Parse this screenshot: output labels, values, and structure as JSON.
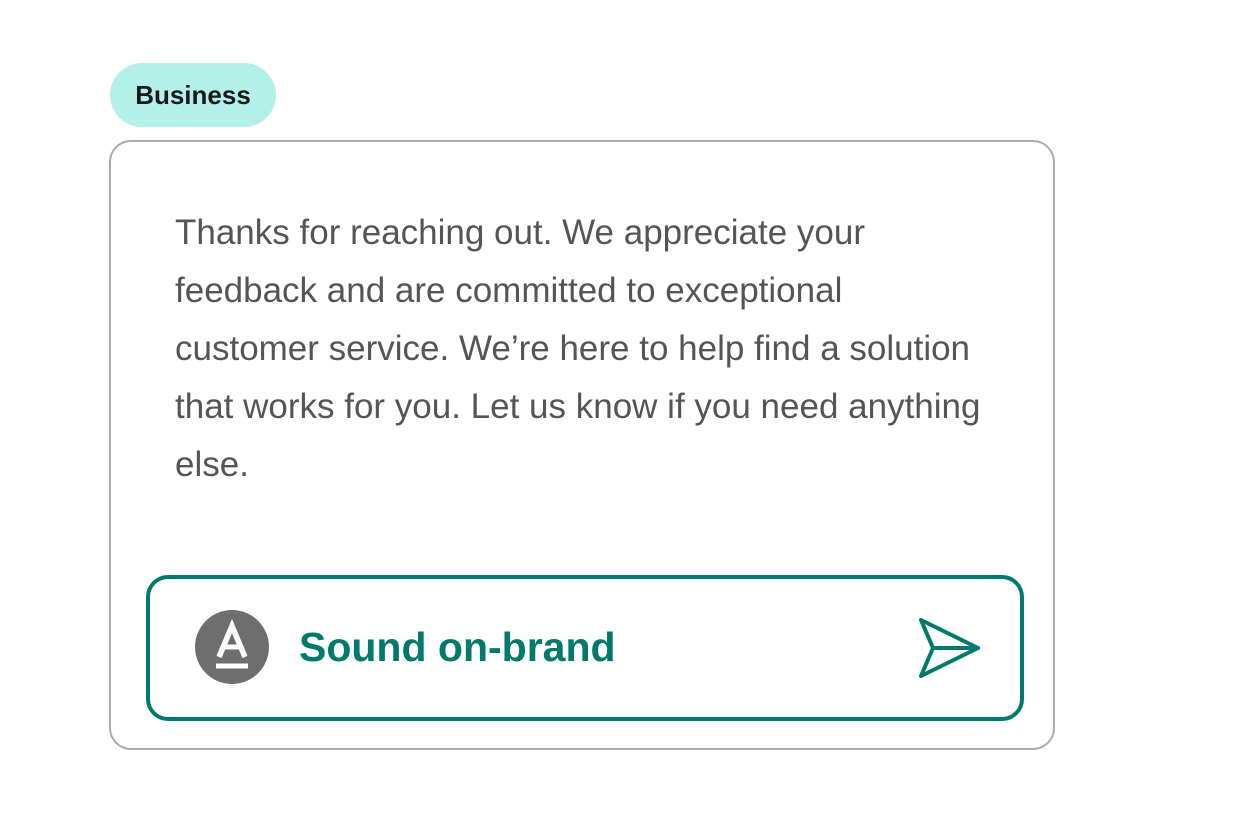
{
  "badge": {
    "label": "Business",
    "color": "#b3f0e8"
  },
  "card": {
    "message": "Thanks for reaching out. We appreciate your feedback and are committed to exceptional customer service. We’re here to help find a solution that works for you. Let us know if you need anything else."
  },
  "action": {
    "label": "Sound on-brand",
    "logo_icon": "a-logo-icon",
    "send_icon": "send-icon",
    "accent_color": "#007a6a"
  }
}
